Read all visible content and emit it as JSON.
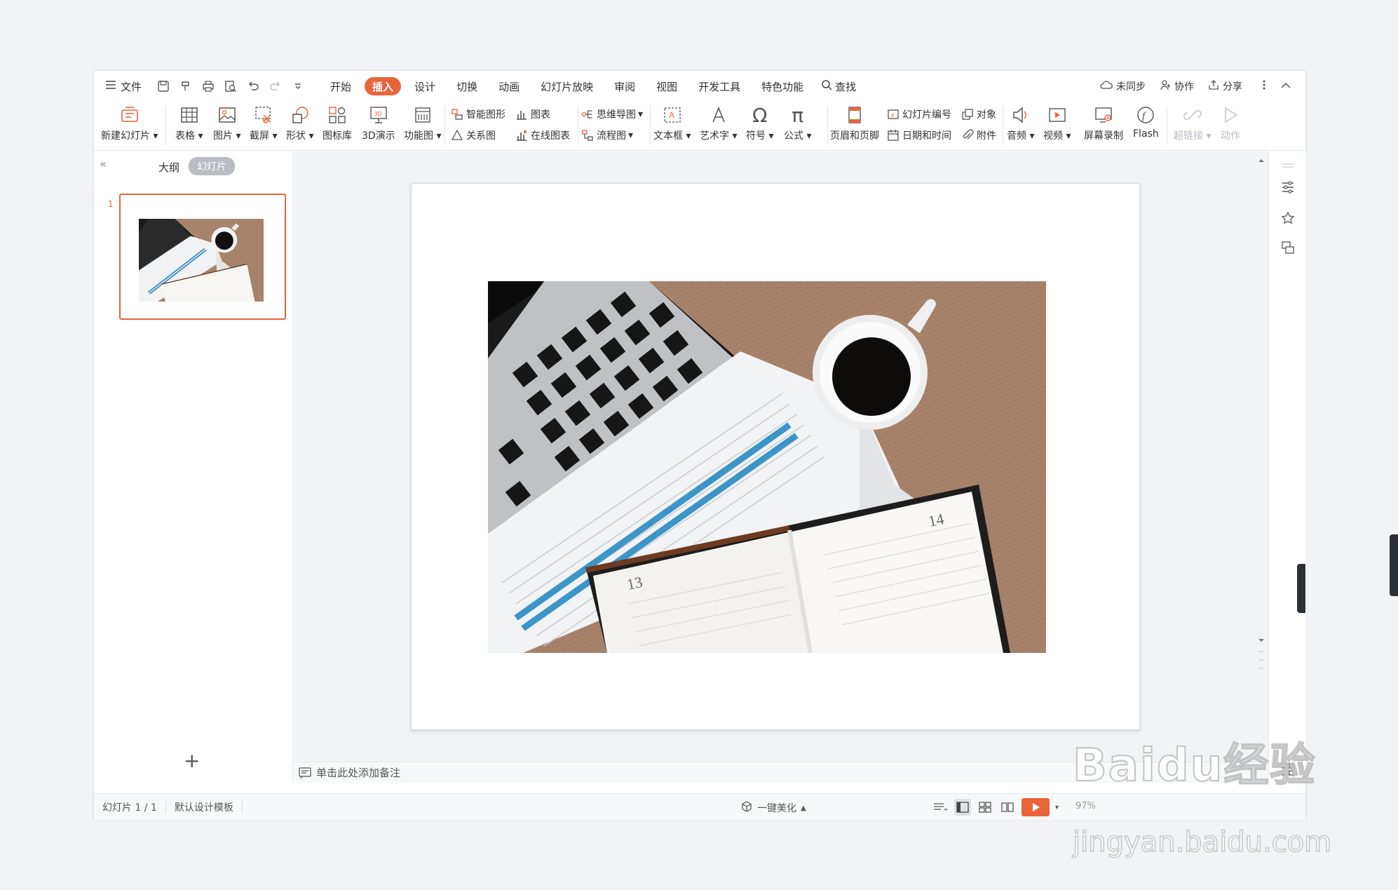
{
  "menu": {
    "file": "文件"
  },
  "tabs": [
    {
      "label": "开始"
    },
    {
      "label": "插入"
    },
    {
      "label": "设计"
    },
    {
      "label": "切换"
    },
    {
      "label": "动画"
    },
    {
      "label": "幻灯片放映"
    },
    {
      "label": "审阅"
    },
    {
      "label": "视图"
    },
    {
      "label": "开发工具"
    },
    {
      "label": "特色功能"
    }
  ],
  "active_tab": "插入",
  "search": {
    "label": "查找"
  },
  "right": {
    "sync": "未同步",
    "collab": "协作",
    "share": "分享"
  },
  "ribbon": {
    "new_slide": "新建幻灯片",
    "table": "表格",
    "picture": "图片",
    "screenshot": "截屏",
    "shape": "形状",
    "icon_lib": "图标库",
    "demo3d": "3D演示",
    "func_chart": "功能图",
    "smart_art": "智能图形",
    "chart": "图表",
    "relation": "关系图",
    "online_chart": "在线图表",
    "mindmap": "思维导图",
    "flowchart": "流程图",
    "textbox": "文本框",
    "wordart": "艺术字",
    "symbol": "符号",
    "formula": "公式",
    "header_footer": "页眉和页脚",
    "slide_number": "幻灯片编号",
    "object": "对象",
    "date_time": "日期和时间",
    "attachment": "附件",
    "audio": "音频",
    "video": "视频",
    "screen_record": "屏幕录制",
    "flash": "Flash",
    "hyperlink": "超链接",
    "action": "动作"
  },
  "panel": {
    "outline": "大纲",
    "slides": "幻灯片",
    "thumb_number": "1"
  },
  "notes": {
    "placeholder": "单击此处添加备注"
  },
  "status": {
    "slide_count": "幻灯片 1 / 1",
    "template": "默认设计模板",
    "beautify": "一键美化",
    "zoom": "97%"
  },
  "watermark": {
    "brand": "Baidu",
    "brand_cn": "经验",
    "url": "jingyan.baidu.com"
  },
  "colors": {
    "accent": "#e8643a",
    "wood": "#a8836c"
  },
  "icons": [
    "menu-icon",
    "save-icon",
    "print-icon",
    "undo-icon",
    "redo-icon",
    "search-icon",
    "cloud-icon",
    "user-icon",
    "share-icon",
    "more-icon",
    "collapse-icon"
  ]
}
